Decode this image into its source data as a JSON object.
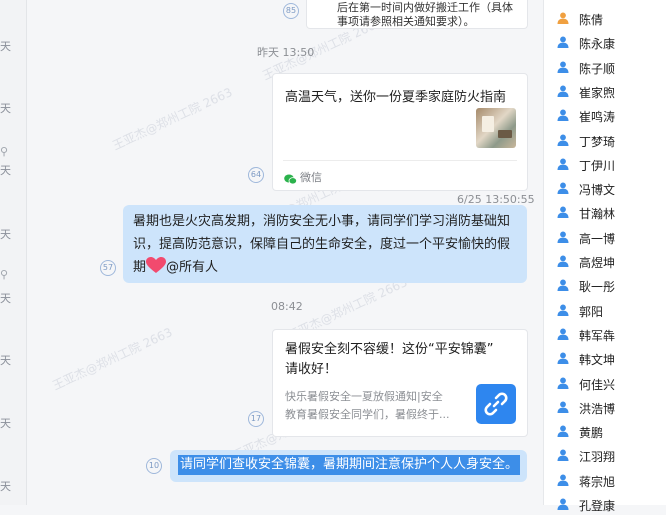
{
  "left_strip": {
    "labels": [
      "天",
      "天",
      "天",
      "天",
      "天",
      "天",
      "天",
      "天",
      "天"
    ]
  },
  "chat": {
    "top_card": {
      "seq": "85",
      "text_line1": "后在第一时间内做好搬迁工作（具体",
      "text_line2": "事项请参照相关通知要求）。"
    },
    "time1": "昨天 13:50",
    "card1": {
      "seq": "64",
      "title": "高温天气，送你一份夏季家庭防火指南",
      "source": "微信",
      "timestamp": "6/25 13:50:55"
    },
    "bubble1": {
      "seq": "57",
      "text_line1": "暑期也是火灾高发期，消防安全无小事，请同学们学习消防基础知",
      "text_line2": "识，提高防范意识，保障自己的生命安全，度过一个平安愉快的假",
      "text_line3_prefix": "期",
      "mention": "@所有人"
    },
    "time2": "08:42",
    "card2": {
      "seq": "17",
      "title_line1": "暑假安全刻不容缓！这份“平安锦囊”",
      "title_line2": "请收好！",
      "desc_line1": "快乐暑假安全一夏放假通知|安全",
      "desc_line2": "教育暑假安全同学们，暑假终于..."
    },
    "bubble2": {
      "seq": "10",
      "text": "请同学们查收安全锦囊，暑期期间注意保护个人人身安全。"
    },
    "watermark_name": "王亚杰@郑州工院 2663",
    "watermark_id": "20208922"
  },
  "members": [
    {
      "name": "陈倩",
      "color": "#f0a040"
    },
    {
      "name": "陈永康",
      "color": "#3d8ee8"
    },
    {
      "name": "陈子顺",
      "color": "#3d8ee8"
    },
    {
      "name": "崔家煦",
      "color": "#3d8ee8"
    },
    {
      "name": "崔鸣涛",
      "color": "#3d8ee8"
    },
    {
      "name": "丁梦琦",
      "color": "#3d8ee8"
    },
    {
      "name": "丁伊川",
      "color": "#3d8ee8"
    },
    {
      "name": "冯博文",
      "color": "#3d8ee8"
    },
    {
      "name": "甘瀚林",
      "color": "#3d8ee8"
    },
    {
      "name": "高一博",
      "color": "#3d8ee8"
    },
    {
      "name": "高煜坤",
      "color": "#3d8ee8"
    },
    {
      "name": "耿一彤",
      "color": "#3d8ee8"
    },
    {
      "name": "郭阳",
      "color": "#3d8ee8"
    },
    {
      "name": "韩军犇",
      "color": "#3d8ee8"
    },
    {
      "name": "韩文坤",
      "color": "#3d8ee8"
    },
    {
      "name": "何佳兴",
      "color": "#3d8ee8"
    },
    {
      "name": "洪浩博",
      "color": "#3d8ee8"
    },
    {
      "name": "黄鹏",
      "color": "#3d8ee8"
    },
    {
      "name": "江羽翔",
      "color": "#3d8ee8"
    },
    {
      "name": "蒋宗旭",
      "color": "#3d8ee8"
    },
    {
      "name": "孔登康",
      "color": "#3d8ee8"
    }
  ]
}
